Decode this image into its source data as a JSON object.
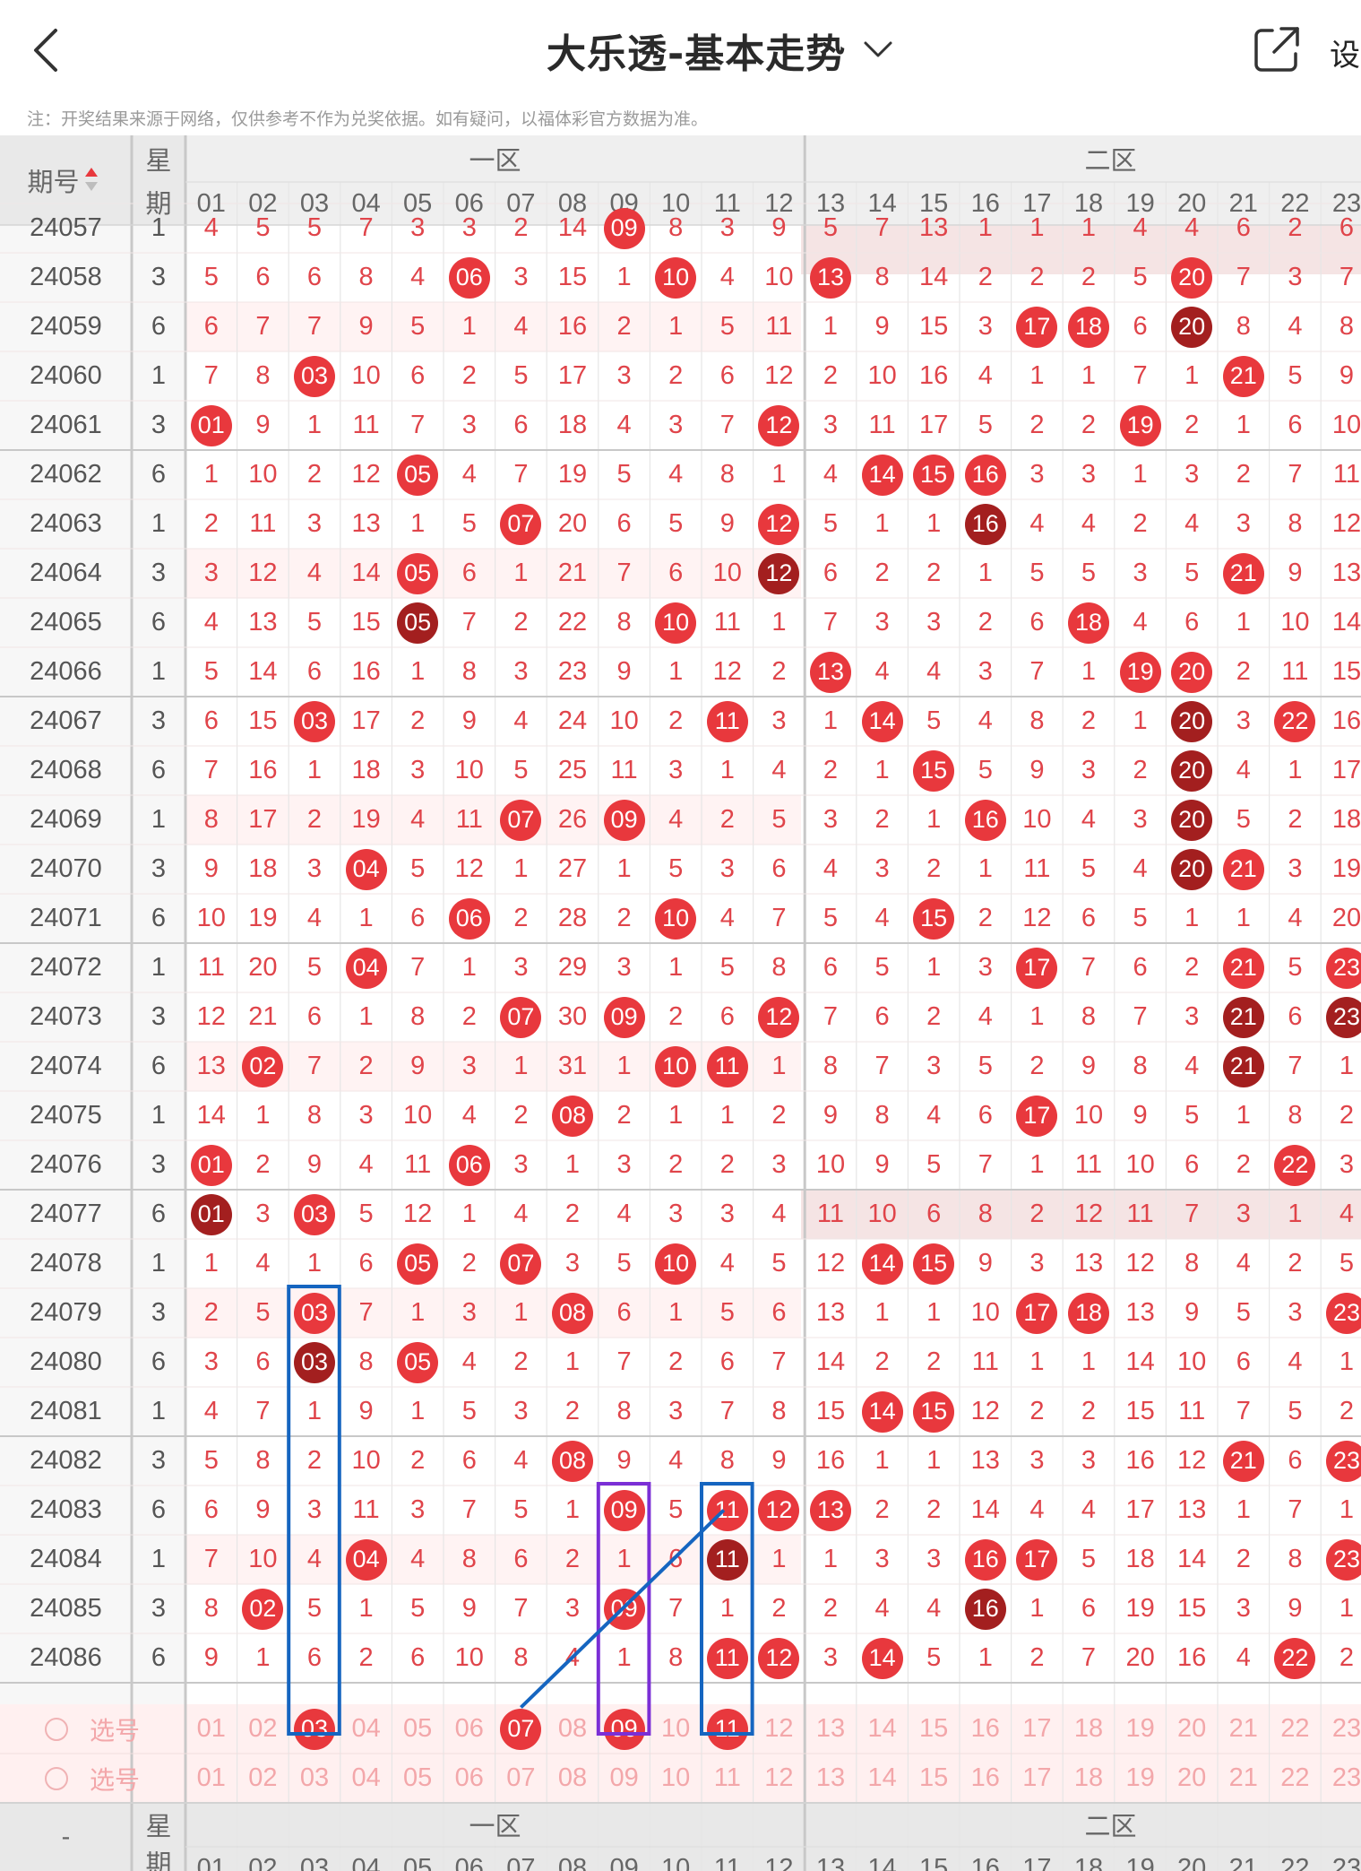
{
  "header": {
    "title": "大乐透-基本走势",
    "set_label": "设",
    "note": "注：开奖结果来源于网络，仅供参考不作为兑奖依据。如有疑问，以福体彩官方数据为准。"
  },
  "table": {
    "issue_header": "期号",
    "week_header_1": "星",
    "week_header_2": "期",
    "zone1_label": "一区",
    "zone2_label": "二区",
    "columns": [
      "01",
      "02",
      "03",
      "04",
      "05",
      "06",
      "07",
      "08",
      "09",
      "10",
      "11",
      "12",
      "13",
      "14",
      "15",
      "16",
      "17",
      "18",
      "19",
      "20",
      "21",
      "22",
      "23"
    ],
    "rows": [
      {
        "issue": "24057",
        "week": "1",
        "cells": [
          "4",
          "5",
          "5",
          "7",
          "3",
          "3",
          "2",
          "14",
          "09",
          "8",
          "3",
          "9",
          "5",
          "7",
          "13",
          "1",
          "1",
          "1",
          "4",
          "4",
          "6",
          "2",
          "6"
        ],
        "hits": [
          8
        ]
      },
      {
        "issue": "24058",
        "week": "3",
        "cells": [
          "5",
          "6",
          "6",
          "8",
          "4",
          "06",
          "3",
          "15",
          "1",
          "10",
          "4",
          "10",
          "13",
          "8",
          "14",
          "2",
          "2",
          "2",
          "5",
          "20",
          "7",
          "3",
          "7"
        ],
        "hits": [
          5,
          9,
          12,
          19
        ]
      },
      {
        "issue": "24059",
        "week": "6",
        "cells": [
          "6",
          "7",
          "7",
          "9",
          "5",
          "1",
          "4",
          "16",
          "2",
          "1",
          "5",
          "11",
          "1",
          "9",
          "15",
          "3",
          "17",
          "18",
          "6",
          "20",
          "8",
          "4",
          "8"
        ],
        "hits": [
          16,
          17,
          19
        ]
      },
      {
        "issue": "24060",
        "week": "1",
        "cells": [
          "7",
          "8",
          "03",
          "10",
          "6",
          "2",
          "5",
          "17",
          "3",
          "2",
          "6",
          "12",
          "2",
          "10",
          "16",
          "4",
          "1",
          "1",
          "7",
          "1",
          "21",
          "5",
          "9"
        ],
        "hits": [
          2,
          20
        ]
      },
      {
        "issue": "24061",
        "week": "3",
        "cells": [
          "01",
          "9",
          "1",
          "11",
          "7",
          "3",
          "6",
          "18",
          "4",
          "3",
          "7",
          "12",
          "3",
          "11",
          "17",
          "5",
          "2",
          "2",
          "19",
          "2",
          "1",
          "6",
          "10"
        ],
        "hits": [
          0,
          11,
          18
        ]
      },
      {
        "issue": "24062",
        "week": "6",
        "cells": [
          "1",
          "10",
          "2",
          "12",
          "05",
          "4",
          "7",
          "19",
          "5",
          "4",
          "8",
          "1",
          "4",
          "14",
          "15",
          "16",
          "3",
          "3",
          "1",
          "3",
          "2",
          "7",
          "11"
        ],
        "hits": [
          4,
          13,
          14,
          15
        ]
      },
      {
        "issue": "24063",
        "week": "1",
        "cells": [
          "2",
          "11",
          "3",
          "13",
          "1",
          "5",
          "07",
          "20",
          "6",
          "5",
          "9",
          "12",
          "5",
          "1",
          "1",
          "16",
          "4",
          "4",
          "2",
          "4",
          "3",
          "8",
          "12"
        ],
        "hits": [
          6,
          11,
          15
        ]
      },
      {
        "issue": "24064",
        "week": "3",
        "cells": [
          "3",
          "12",
          "4",
          "14",
          "05",
          "6",
          "1",
          "21",
          "7",
          "6",
          "10",
          "12",
          "6",
          "2",
          "2",
          "1",
          "5",
          "5",
          "3",
          "5",
          "21",
          "9",
          "13"
        ],
        "hits": [
          4,
          11,
          20
        ]
      },
      {
        "issue": "24065",
        "week": "6",
        "cells": [
          "4",
          "13",
          "5",
          "15",
          "05",
          "7",
          "2",
          "22",
          "8",
          "10",
          "11",
          "1",
          "7",
          "3",
          "3",
          "2",
          "6",
          "18",
          "4",
          "6",
          "1",
          "10",
          "14"
        ],
        "hits": [
          4,
          9,
          17
        ]
      },
      {
        "issue": "24066",
        "week": "1",
        "cells": [
          "5",
          "14",
          "6",
          "16",
          "1",
          "8",
          "3",
          "23",
          "9",
          "1",
          "12",
          "2",
          "13",
          "4",
          "4",
          "3",
          "7",
          "1",
          "19",
          "20",
          "2",
          "11",
          "15"
        ],
        "hits": [
          12,
          18,
          19
        ]
      },
      {
        "issue": "24067",
        "week": "3",
        "cells": [
          "6",
          "15",
          "03",
          "17",
          "2",
          "9",
          "4",
          "24",
          "10",
          "2",
          "11",
          "3",
          "1",
          "14",
          "5",
          "4",
          "8",
          "2",
          "1",
          "20",
          "3",
          "22",
          "16"
        ],
        "hits": [
          2,
          10,
          13,
          19,
          21
        ]
      },
      {
        "issue": "24068",
        "week": "6",
        "cells": [
          "7",
          "16",
          "1",
          "18",
          "3",
          "10",
          "5",
          "25",
          "11",
          "3",
          "1",
          "4",
          "2",
          "1",
          "15",
          "5",
          "9",
          "3",
          "2",
          "20",
          "4",
          "1",
          "17"
        ],
        "hits": [
          14,
          19
        ]
      },
      {
        "issue": "24069",
        "week": "1",
        "cells": [
          "8",
          "17",
          "2",
          "19",
          "4",
          "11",
          "07",
          "26",
          "09",
          "4",
          "2",
          "5",
          "3",
          "2",
          "1",
          "16",
          "10",
          "4",
          "3",
          "20",
          "5",
          "2",
          "18"
        ],
        "hits": [
          6,
          8,
          15,
          19
        ]
      },
      {
        "issue": "24070",
        "week": "3",
        "cells": [
          "9",
          "18",
          "3",
          "04",
          "5",
          "12",
          "1",
          "27",
          "1",
          "5",
          "3",
          "6",
          "4",
          "3",
          "2",
          "1",
          "11",
          "5",
          "4",
          "20",
          "21",
          "3",
          "19"
        ],
        "hits": [
          3,
          19,
          20
        ]
      },
      {
        "issue": "24071",
        "week": "6",
        "cells": [
          "10",
          "19",
          "4",
          "1",
          "6",
          "06",
          "2",
          "28",
          "2",
          "10",
          "4",
          "7",
          "5",
          "4",
          "15",
          "2",
          "12",
          "6",
          "5",
          "1",
          "1",
          "4",
          "20"
        ],
        "hits": [
          5,
          9,
          14
        ]
      },
      {
        "issue": "24072",
        "week": "1",
        "cells": [
          "11",
          "20",
          "5",
          "04",
          "7",
          "1",
          "3",
          "29",
          "3",
          "1",
          "5",
          "8",
          "6",
          "5",
          "1",
          "3",
          "17",
          "7",
          "6",
          "2",
          "21",
          "5",
          "23"
        ],
        "hits": [
          3,
          16,
          20,
          22
        ]
      },
      {
        "issue": "24073",
        "week": "3",
        "cells": [
          "12",
          "21",
          "6",
          "1",
          "8",
          "2",
          "07",
          "30",
          "09",
          "2",
          "6",
          "12",
          "7",
          "6",
          "2",
          "4",
          "1",
          "8",
          "7",
          "3",
          "21",
          "6",
          "23"
        ],
        "hits": [
          6,
          8,
          11,
          20,
          22
        ]
      },
      {
        "issue": "24074",
        "week": "6",
        "cells": [
          "13",
          "02",
          "7",
          "2",
          "9",
          "3",
          "1",
          "31",
          "1",
          "10",
          "11",
          "1",
          "8",
          "7",
          "3",
          "5",
          "2",
          "9",
          "8",
          "4",
          "21",
          "7",
          "1"
        ],
        "hits": [
          1,
          9,
          10,
          20
        ]
      },
      {
        "issue": "24075",
        "week": "1",
        "cells": [
          "14",
          "1",
          "8",
          "3",
          "10",
          "4",
          "2",
          "08",
          "2",
          "1",
          "1",
          "2",
          "9",
          "8",
          "4",
          "6",
          "17",
          "10",
          "9",
          "5",
          "1",
          "8",
          "2"
        ],
        "hits": [
          7,
          16
        ]
      },
      {
        "issue": "24076",
        "week": "3",
        "cells": [
          "01",
          "2",
          "9",
          "4",
          "11",
          "06",
          "3",
          "1",
          "3",
          "2",
          "2",
          "3",
          "10",
          "9",
          "5",
          "7",
          "1",
          "11",
          "10",
          "6",
          "2",
          "22",
          "3"
        ],
        "hits": [
          0,
          5,
          21
        ]
      },
      {
        "issue": "24077",
        "week": "6",
        "cells": [
          "01",
          "3",
          "03",
          "5",
          "12",
          "1",
          "4",
          "2",
          "4",
          "3",
          "3",
          "4",
          "11",
          "10",
          "6",
          "8",
          "2",
          "12",
          "11",
          "7",
          "3",
          "1",
          "4"
        ],
        "hits": [
          0,
          2
        ]
      },
      {
        "issue": "24078",
        "week": "1",
        "cells": [
          "1",
          "4",
          "1",
          "6",
          "05",
          "2",
          "07",
          "3",
          "5",
          "10",
          "4",
          "5",
          "12",
          "14",
          "15",
          "9",
          "3",
          "13",
          "12",
          "8",
          "4",
          "2",
          "5"
        ],
        "hits": [
          4,
          6,
          9,
          13,
          14
        ]
      },
      {
        "issue": "24079",
        "week": "3",
        "cells": [
          "2",
          "5",
          "03",
          "7",
          "1",
          "3",
          "1",
          "08",
          "6",
          "1",
          "5",
          "6",
          "13",
          "1",
          "1",
          "10",
          "17",
          "18",
          "13",
          "9",
          "5",
          "3",
          "23"
        ],
        "hits": [
          2,
          7,
          16,
          17,
          22
        ]
      },
      {
        "issue": "24080",
        "week": "6",
        "cells": [
          "3",
          "6",
          "03",
          "8",
          "05",
          "4",
          "2",
          "1",
          "7",
          "2",
          "6",
          "7",
          "14",
          "2",
          "2",
          "11",
          "1",
          "1",
          "14",
          "10",
          "6",
          "4",
          "1"
        ],
        "hits": [
          2,
          4
        ]
      },
      {
        "issue": "24081",
        "week": "1",
        "cells": [
          "4",
          "7",
          "1",
          "9",
          "1",
          "5",
          "3",
          "2",
          "8",
          "3",
          "7",
          "8",
          "15",
          "14",
          "15",
          "12",
          "2",
          "2",
          "15",
          "11",
          "7",
          "5",
          "2"
        ],
        "hits": [
          13,
          14
        ]
      },
      {
        "issue": "24082",
        "week": "3",
        "cells": [
          "5",
          "8",
          "2",
          "10",
          "2",
          "6",
          "4",
          "08",
          "9",
          "4",
          "8",
          "9",
          "16",
          "1",
          "1",
          "13",
          "3",
          "3",
          "16",
          "12",
          "21",
          "6",
          "23"
        ],
        "hits": [
          7,
          20,
          22
        ]
      },
      {
        "issue": "24083",
        "week": "6",
        "cells": [
          "6",
          "9",
          "3",
          "11",
          "3",
          "7",
          "5",
          "1",
          "09",
          "5",
          "11",
          "12",
          "13",
          "2",
          "2",
          "14",
          "4",
          "4",
          "17",
          "13",
          "1",
          "7",
          "1"
        ],
        "hits": [
          8,
          10,
          11,
          12
        ]
      },
      {
        "issue": "24084",
        "week": "1",
        "cells": [
          "7",
          "10",
          "4",
          "04",
          "4",
          "8",
          "6",
          "2",
          "1",
          "6",
          "11",
          "1",
          "1",
          "3",
          "3",
          "16",
          "17",
          "5",
          "18",
          "14",
          "2",
          "8",
          "23"
        ],
        "hits": [
          3,
          10,
          15,
          16,
          22
        ]
      },
      {
        "issue": "24085",
        "week": "3",
        "cells": [
          "8",
          "02",
          "5",
          "1",
          "5",
          "9",
          "7",
          "3",
          "09",
          "7",
          "1",
          "2",
          "2",
          "4",
          "4",
          "16",
          "1",
          "6",
          "19",
          "15",
          "3",
          "9",
          "1"
        ],
        "hits": [
          1,
          8,
          15
        ]
      },
      {
        "issue": "24086",
        "week": "6",
        "cells": [
          "9",
          "1",
          "6",
          "2",
          "6",
          "10",
          "8",
          "4",
          "1",
          "8",
          "11",
          "12",
          "3",
          "14",
          "5",
          "1",
          "2",
          "7",
          "20",
          "16",
          "4",
          "22",
          "2"
        ],
        "hits": [
          10,
          11,
          13,
          21
        ]
      }
    ],
    "select_label": "选号",
    "select_rows": [
      {
        "selected": [
          "03",
          "07",
          "09",
          "11"
        ]
      },
      {
        "selected": []
      }
    ]
  },
  "colors": {
    "accent_red": "#e8383d",
    "repeat_red": "#a31f1f",
    "annotation_blue": "#1565c0",
    "annotation_purple": "#7b2fd6"
  }
}
